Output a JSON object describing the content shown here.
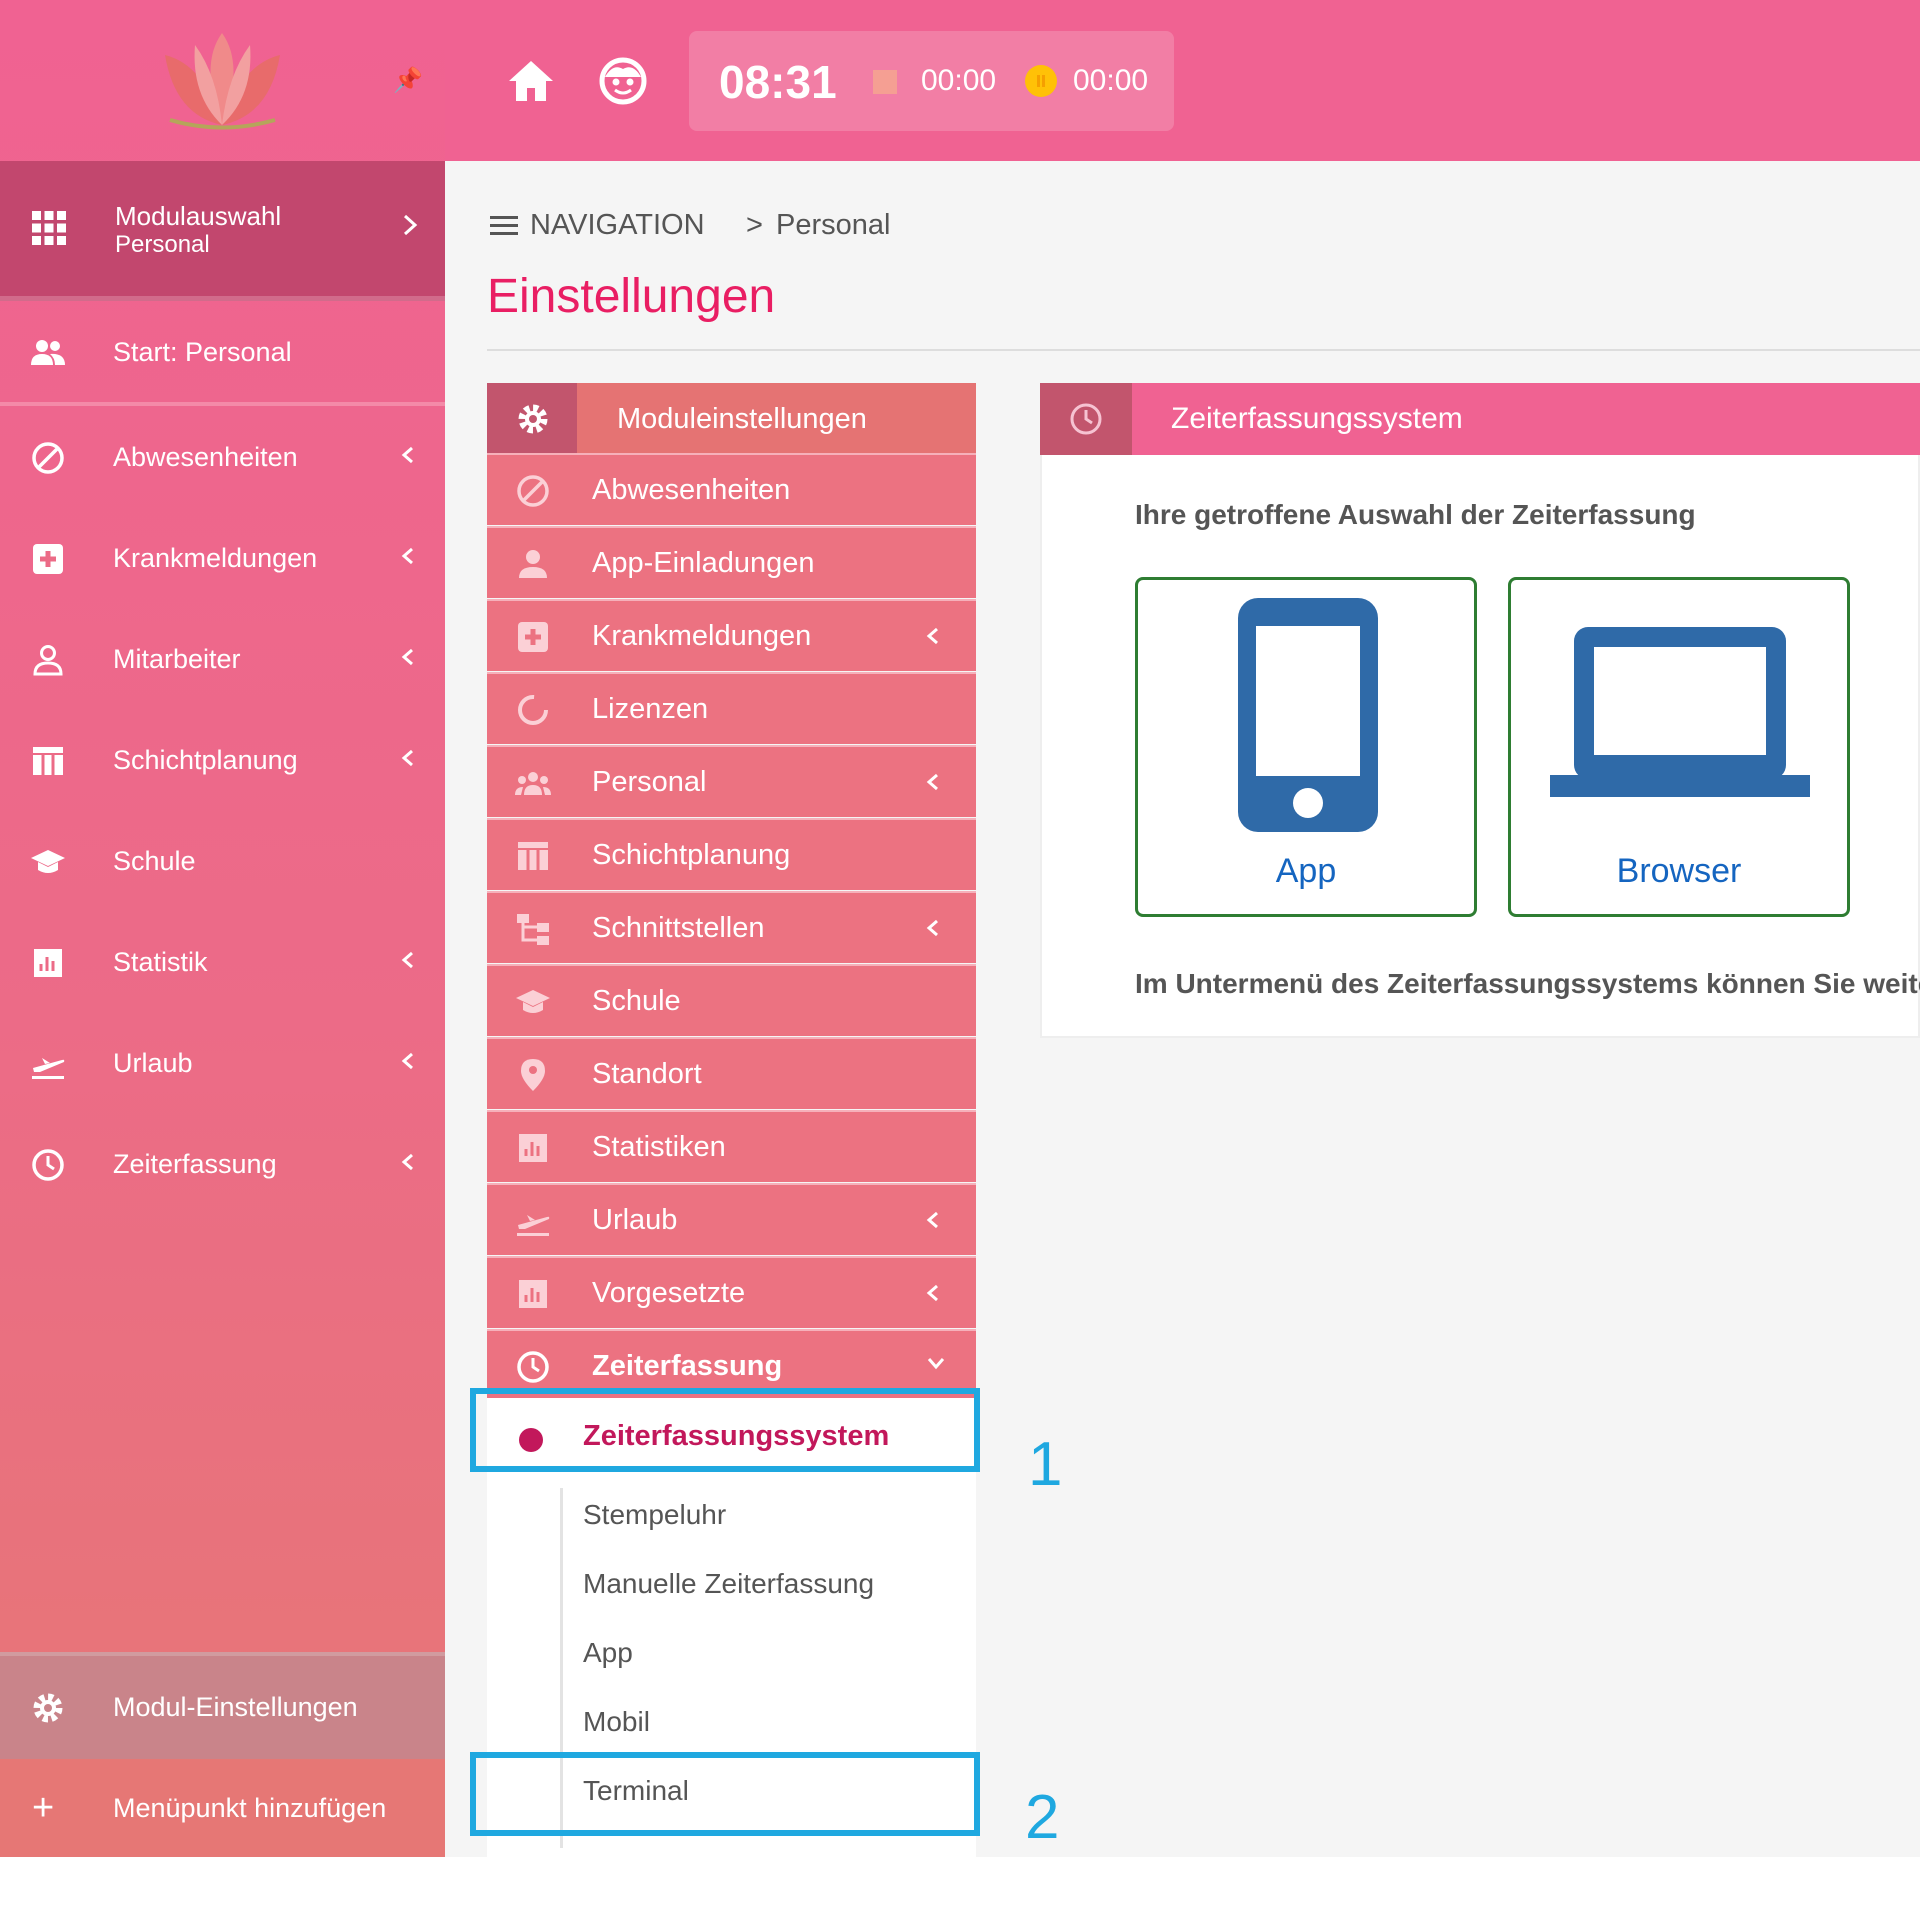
{
  "topbar": {
    "clock": "08:31",
    "stop_time": "00:00",
    "pause_time": "00:00",
    "icons": [
      "home-icon",
      "smiley-face-icon"
    ]
  },
  "sidebar": {
    "module_select": {
      "title": "Modulauswahl",
      "subtitle": "Personal"
    },
    "start": "Start: Personal",
    "items": [
      {
        "label": "Abwesenheiten",
        "icon": "block-icon"
      },
      {
        "label": "Krankmeldungen",
        "icon": "medical-icon"
      },
      {
        "label": "Mitarbeiter",
        "icon": "person-icon"
      },
      {
        "label": "Schichtplanung",
        "icon": "calendar-icon"
      },
      {
        "label": "Schule",
        "icon": "graduation-cap-icon"
      },
      {
        "label": "Statistik",
        "icon": "chart-icon"
      },
      {
        "label": "Urlaub",
        "icon": "airplane-icon"
      },
      {
        "label": "Zeiterfassung",
        "icon": "clock-icon"
      }
    ],
    "modul_settings": "Modul-Einstellungen",
    "add_menu": "Menüpunkt hinzufügen"
  },
  "breadcrumb": {
    "nav": "NAVIGATION",
    "separator": ">",
    "current": "Personal"
  },
  "page_title": "Einstellungen",
  "settings_menu": {
    "header": "Moduleinstellungen",
    "items": [
      {
        "label": "Abwesenheiten"
      },
      {
        "label": "App-Einladungen"
      },
      {
        "label": "Krankmeldungen"
      },
      {
        "label": "Lizenzen"
      },
      {
        "label": "Personal"
      },
      {
        "label": "Schichtplanung"
      },
      {
        "label": "Schnittstellen"
      },
      {
        "label": "Schule"
      },
      {
        "label": "Standort"
      },
      {
        "label": "Statistiken"
      },
      {
        "label": "Urlaub"
      },
      {
        "label": "Vorgesetzte"
      },
      {
        "label": "Zeiterfassung"
      }
    ],
    "submenu": {
      "active": "Zeiterfassungssystem",
      "items": [
        "Stempeluhr",
        "Manuelle Zeiterfassung",
        "App",
        "Mobil",
        "Terminal"
      ]
    }
  },
  "annotations": [
    "1",
    "2"
  ],
  "card": {
    "title": "Zeiterfassungssystem",
    "description": "Ihre getroffene Auswahl der Zeiterfassung",
    "options": [
      {
        "label": "App"
      },
      {
        "label": "Browser"
      }
    ],
    "note": "Im Untermenü des Zeiterfassungssystems können Sie weitere"
  },
  "colors": {
    "primary": "#f06292",
    "accent_text": "#e91e63",
    "active_sub": "#c2185b",
    "annotation": "#1fa8e0",
    "device_blue": "#2f6aa8",
    "choice_border": "#2e7d32"
  }
}
